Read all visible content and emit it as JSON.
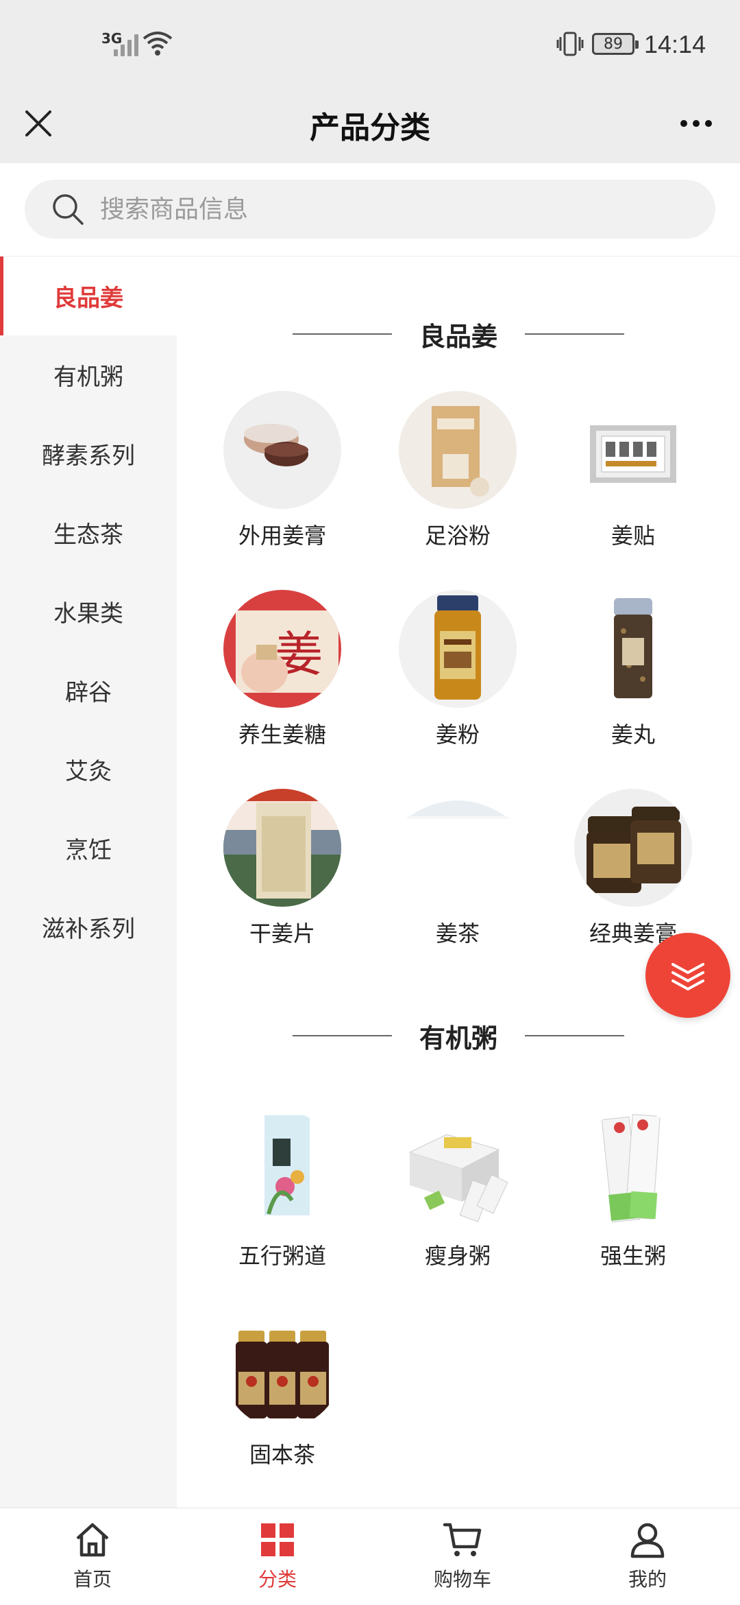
{
  "status_bar": {
    "network": "3G",
    "battery": "89",
    "time": "14:14"
  },
  "header": {
    "title": "产品分类"
  },
  "search": {
    "placeholder": "搜索商品信息"
  },
  "sidebar": {
    "items": [
      {
        "label": "良品姜"
      },
      {
        "label": "有机粥"
      },
      {
        "label": "酵素系列"
      },
      {
        "label": "生态茶"
      },
      {
        "label": "水果类"
      },
      {
        "label": "辟谷"
      },
      {
        "label": "艾灸"
      },
      {
        "label": "烹饪"
      },
      {
        "label": "滋补系列"
      }
    ]
  },
  "sections": [
    {
      "title": "良品姜",
      "products": [
        {
          "name": "外用姜膏"
        },
        {
          "name": "足浴粉"
        },
        {
          "name": "姜贴"
        },
        {
          "name": "养生姜糖"
        },
        {
          "name": "姜粉"
        },
        {
          "name": "姜丸"
        },
        {
          "name": "干姜片"
        },
        {
          "name": "姜茶"
        },
        {
          "name": "经典姜膏"
        }
      ]
    },
    {
      "title": "有机粥",
      "products": [
        {
          "name": "五行粥道"
        },
        {
          "name": "瘦身粥"
        },
        {
          "name": "强生粥"
        },
        {
          "name": "固本茶"
        }
      ]
    }
  ],
  "tabbar": {
    "items": [
      {
        "label": "首页"
      },
      {
        "label": "分类"
      },
      {
        "label": "购物车"
      },
      {
        "label": "我的"
      }
    ]
  },
  "colors": {
    "accent": "#e03a3a",
    "fab": "#ee4438",
    "header_bg": "#ededed",
    "sidebar_bg": "#f5f5f5"
  }
}
